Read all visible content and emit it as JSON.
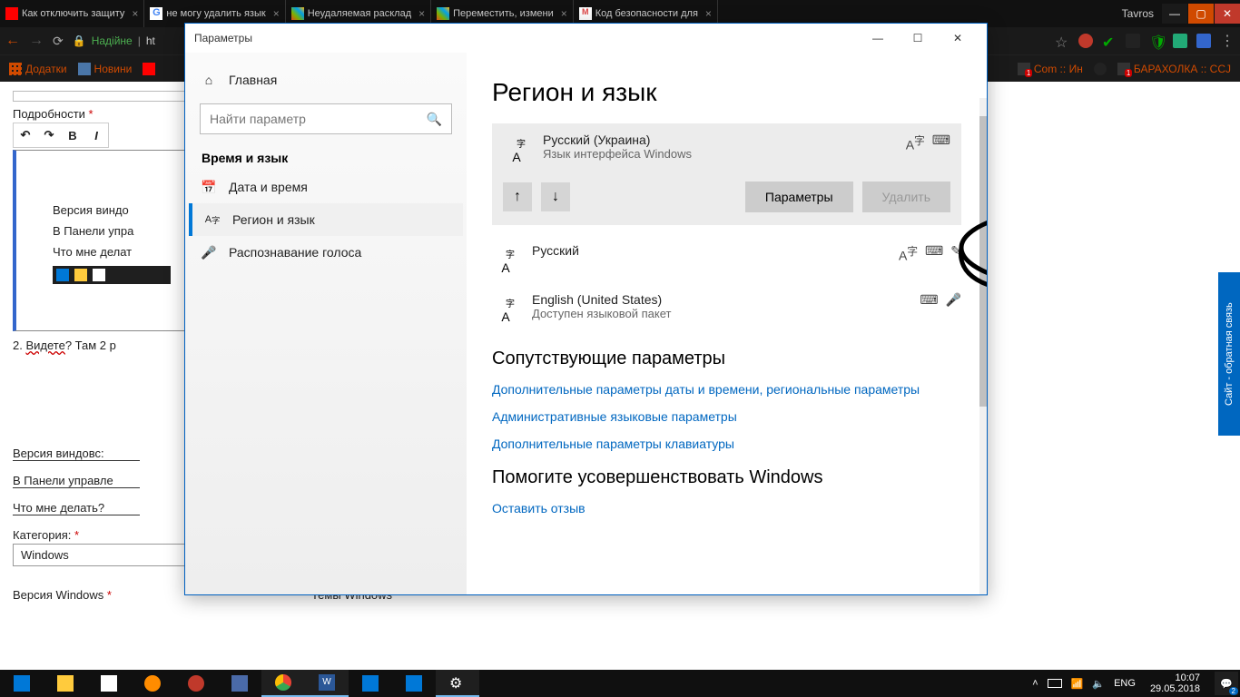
{
  "browser": {
    "tabs": [
      {
        "label": "Как отключить защиту",
        "icon_color": "#f00"
      },
      {
        "label": "не могу удалить язык",
        "icon_color": "#4285f4"
      },
      {
        "label": "Неудаляемая расклад",
        "icon_color": "#0078d7"
      },
      {
        "label": "Переместить, измени",
        "icon_color": "#0078d7"
      },
      {
        "label": "Код безопасности для",
        "icon_color": "#d44"
      }
    ],
    "user": "Tavros",
    "secure_label": "Надійне",
    "url_prefix": "ht",
    "bookmarks": {
      "apps": "Додатки",
      "news": "Новини",
      "com": "Com :: Ин",
      "bara": "БАРАХОЛКА :: CCJ"
    }
  },
  "page": {
    "details_label": "Подробности",
    "line1": "Версия виндо",
    "line2": "В Панели упра",
    "line3": "Что мне делат",
    "after1_prefix": "2. ",
    "after1_link": "Видете",
    "after1_rest": "? Там 2 р",
    "line1b": "Версия виндовс:",
    "line2b": "В Панели управле",
    "line3b": "Что мне делать?",
    "category_label": "Категория:",
    "category_value": "Windows",
    "winver_label": "Версия Windows",
    "themes_label": "Темы Windows"
  },
  "settings": {
    "title": "Параметры",
    "sidebar": {
      "home": "Главная",
      "search_placeholder": "Найти параметр",
      "section": "Время и язык",
      "items": [
        {
          "icon": "📅",
          "label": "Дата и время"
        },
        {
          "icon": "A字",
          "label": "Регион и язык"
        },
        {
          "icon": "🎤",
          "label": "Распознавание голоса"
        }
      ]
    },
    "main": {
      "heading": "Регион и язык",
      "langs": [
        {
          "title": "Русский (Украина)",
          "sub": "Язык интерфейса Windows",
          "selected": true
        },
        {
          "title": "Русский",
          "sub": ""
        },
        {
          "title": "English (United States)",
          "sub": "Доступен языковой пакет"
        }
      ],
      "btn_options": "Параметры",
      "btn_remove": "Удалить",
      "related_heading": "Сопутствующие параметры",
      "links": [
        "Дополнительные параметры даты и времени, региональные параметры",
        "Административные языковые параметры",
        "Дополнительные параметры клавиатуры"
      ],
      "improve_heading": "Помогите усовершенствовать Windows",
      "feedback_link": "Оставить отзыв"
    }
  },
  "feedback_tab": "Сайт - обратная связь",
  "taskbar": {
    "lang": "ENG",
    "time": "10:07",
    "date": "29.05.2018",
    "notif_count": "2"
  }
}
